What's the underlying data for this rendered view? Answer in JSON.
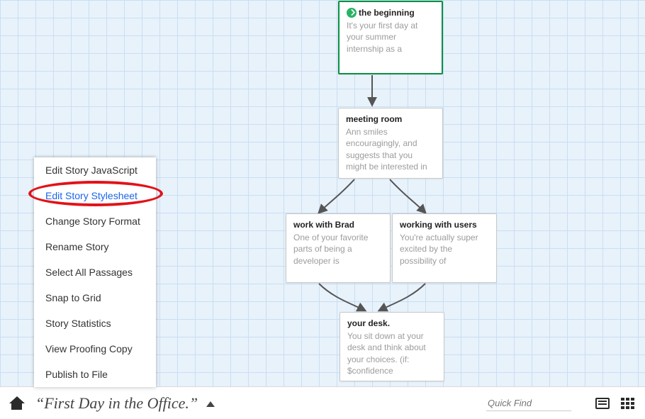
{
  "story_title": "“First Day in the Office.”",
  "quick_find_placeholder": "Quick Find",
  "menu": {
    "items": [
      {
        "label": "Edit Story JavaScript",
        "selected": false
      },
      {
        "label": "Edit Story Stylesheet",
        "selected": true
      },
      {
        "label": "Change Story Format",
        "selected": false
      },
      {
        "label": "Rename Story",
        "selected": false
      },
      {
        "label": "Select All Passages",
        "selected": false
      },
      {
        "label": "Snap to Grid",
        "selected": false
      },
      {
        "label": "Story Statistics",
        "selected": false
      },
      {
        "label": "View Proofing Copy",
        "selected": false
      },
      {
        "label": "Publish to File",
        "selected": false
      }
    ]
  },
  "nodes": {
    "beginning": {
      "title": "the beginning",
      "body": "It's your first day at your summer internship as a",
      "start": true
    },
    "meeting_room": {
      "title": "meeting room",
      "body": "Ann smiles encouragingly, and suggests that you might be interested in"
    },
    "work_brad": {
      "title": "work with Brad",
      "body": "One of your favorite parts of being a developer is"
    },
    "working_users": {
      "title": "working with users",
      "body": "You're actually super excited by the possibility of"
    },
    "your_desk": {
      "title": "your desk.",
      "body": "You sit down at your desk and think about your choices. (if: $confidence"
    }
  }
}
